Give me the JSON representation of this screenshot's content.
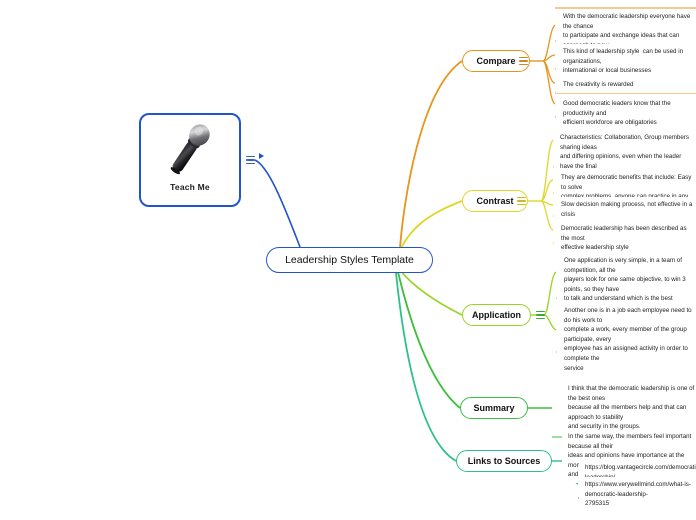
{
  "root": {
    "label": "Leadership Styles Template"
  },
  "image_node": {
    "caption": "Teach Me",
    "icon": "microphone-image"
  },
  "branches": [
    {
      "id": "compare",
      "label": "Compare",
      "color": "#e8951e",
      "leaves": [
        "With the democratic leadership everyone have the chance\nto participate and exchange ideas that can approach to new\ndecisions.",
        "This kind of leadership style  can be used in organizations,\ninternational or local businesses",
        "The creativity is rewarded",
        "Good democratic leaders know that the productivity and\nefficient workforce are obligatories"
      ]
    },
    {
      "id": "contrast",
      "label": "Contrast",
      "color": "#ded82a",
      "leaves": [
        "Characteristics: Collaboration, Group members sharing ideas\nand differing opinions, even when the leader have the final\ndecision.",
        "They are democratic benefits that include: Easy to solve\ncomplex problems, anyone can practice in any industry",
        "Slow decision making process, not effective in a crisis",
        "Democratic leadership has been described as the most\neffective leadership style"
      ]
    },
    {
      "id": "application",
      "label": "Application",
      "color": "#9ad424",
      "leaves": [
        "One application is very simple, in a team of competition, all the\nplayers look for one same objective, to win 3 points, so they have\nto talk and understand which is the best strategy they can use to\nget the win.",
        "Another one is in a job each employee need to do his work to\ncomplete a work, every member of the group participate, every\nemployee has an assigned activity in order to complete the\nservice"
      ]
    },
    {
      "id": "summary",
      "label": "Summary",
      "color": "#3bbf3b",
      "leaves": [
        "I think that the democratic leadership is one of the best ones\nbecause all the members help and that can approach to stability\nand security in the groups.\nIn the same way, the members feel important because all their\nideas and opinions have importance at the moment to solve a doubt\nand issue or just to know their opinions"
      ]
    },
    {
      "id": "links",
      "label": "Links to Sources",
      "color": "#2fc08a",
      "leaves": [
        "https://blog.vantagecircle.com/democratic-leadership/",
        "https://www.verywellmind.com/what-is-democratic-leadership-\n2795315"
      ]
    }
  ]
}
